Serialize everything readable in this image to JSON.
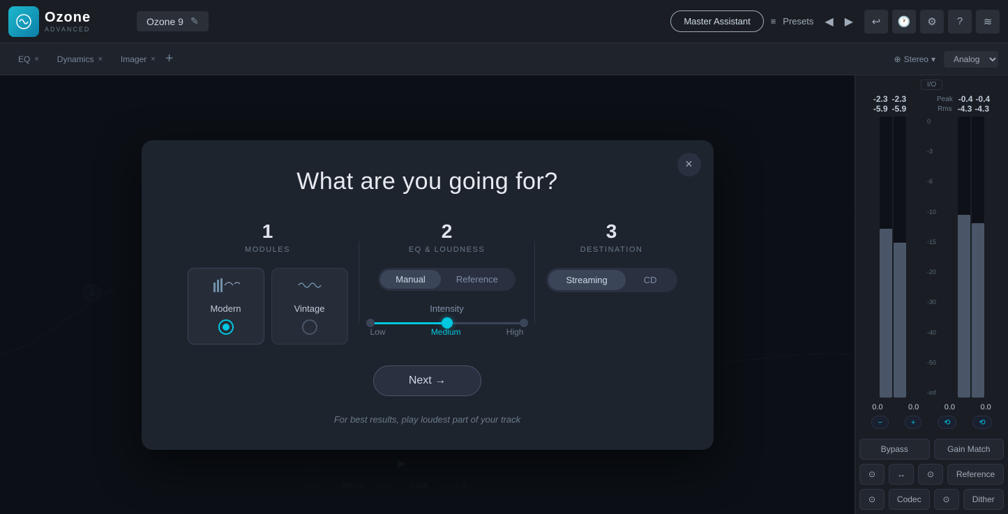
{
  "app": {
    "logo_title": "Ozone",
    "logo_sub": "ADVANCED",
    "preset_name": "Ozone 9",
    "edit_icon": "✎"
  },
  "top_bar": {
    "master_assistant": "Master Assistant",
    "presets_label": "Presets",
    "list_icon": "≡"
  },
  "modules": {
    "eq_label": "EQ",
    "dynamics_label": "Dynamics",
    "imager_label": "Imager"
  },
  "secondary_bar": {
    "analog_label": "Analog",
    "stereo_label": "Stereo",
    "stereo_icon": "⊕"
  },
  "modal": {
    "title": "What are you going for?",
    "close_icon": "×",
    "step1": {
      "number": "1",
      "label": "MODULES",
      "cards": [
        {
          "name": "Modern",
          "selected": true,
          "icon": "|||~⌇"
        },
        {
          "name": "Vintage",
          "selected": false,
          "icon": "⌇⌇⌇"
        }
      ]
    },
    "step2": {
      "number": "2",
      "label": "EQ & LOUDNESS",
      "toggle_options": [
        "Manual",
        "Reference"
      ],
      "active_toggle": "Manual",
      "intensity_label": "Intensity",
      "intensity_levels": [
        "Low",
        "Medium",
        "High"
      ],
      "active_intensity": "Medium"
    },
    "step3": {
      "number": "3",
      "label": "DESTINATION",
      "dest_options": [
        "Streaming",
        "CD"
      ],
      "active_dest": "Streaming"
    },
    "next_button": "Next →",
    "hint_text": "For best results, play loudest part of your track"
  },
  "right_panel": {
    "io_label": "I/O",
    "peak_label": "Peak",
    "rms_label": "Rms",
    "left_peak": "-2.3",
    "right_peak": "-2.3",
    "left_rms": "-5.9",
    "right_rms": "-5.9",
    "out_peak_l": "-0.4",
    "out_peak_r": "-0.4",
    "out_rms_l": "-4.3",
    "out_rms_r": "-4.3",
    "fader_vals": [
      "0.0",
      "0.0",
      "0.0",
      "0.0"
    ],
    "bypass_label": "Bypass",
    "gain_match_label": "Gain Match",
    "reference_label": "Reference",
    "codec_label": "Codec",
    "dither_label": "Dither"
  },
  "meter_scale": [
    "0",
    "-3",
    "-6",
    "-10",
    "-15",
    "-20",
    "-30",
    "-40",
    "-50",
    "-inf"
  ]
}
